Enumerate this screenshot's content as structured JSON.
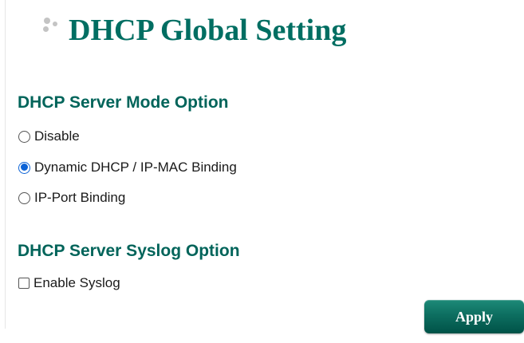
{
  "page": {
    "title": "DHCP Global Setting"
  },
  "server_mode": {
    "heading": "DHCP Server Mode Option",
    "options": [
      {
        "label": "Disable",
        "selected": false
      },
      {
        "label": "Dynamic DHCP / IP-MAC Binding",
        "selected": true
      },
      {
        "label": "IP-Port Binding",
        "selected": false
      }
    ]
  },
  "syslog": {
    "heading": "DHCP Server Syslog Option",
    "enable_label": "Enable Syslog",
    "enabled": false
  },
  "actions": {
    "apply_label": "Apply"
  },
  "colors": {
    "title": "#006e62",
    "heading": "#00645a",
    "radio_selected": "#0b62d6",
    "button": "#0d6e60"
  }
}
